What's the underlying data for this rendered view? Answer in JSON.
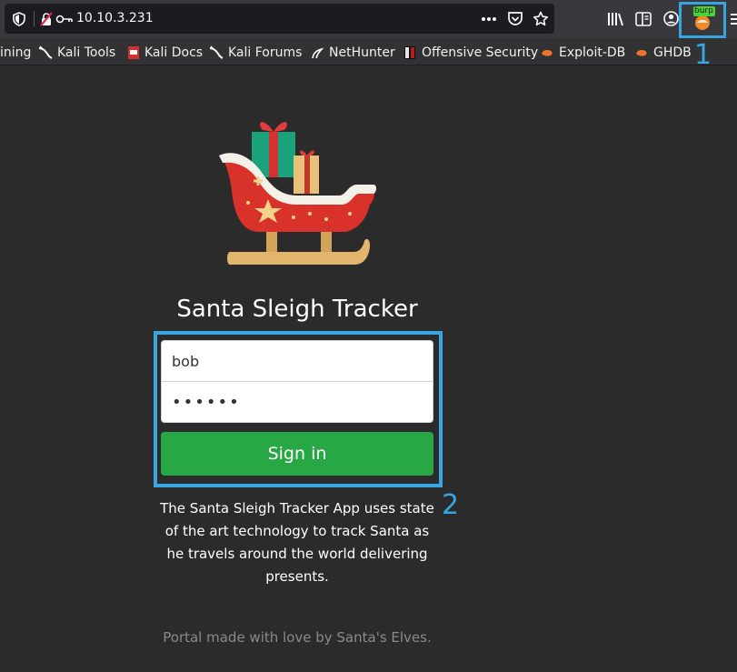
{
  "browser": {
    "url": "10.10.3.231",
    "extension_badge": "burp",
    "icons": [
      "shield-icon",
      "lock-crossed-icon",
      "key-icon",
      "more-icon",
      "pocket-icon",
      "star-icon",
      "library-icon",
      "reader-icon",
      "account-icon",
      "burp-extension-icon",
      "menu-icon"
    ]
  },
  "bookmarks": [
    {
      "label": "ining",
      "icon": "none"
    },
    {
      "label": "Kali Tools",
      "icon": "kali-dragon-icon"
    },
    {
      "label": "Kali Docs",
      "icon": "kali-docs-icon"
    },
    {
      "label": "Kali Forums",
      "icon": "kali-dragon-icon"
    },
    {
      "label": "NetHunter",
      "icon": "nethunter-icon"
    },
    {
      "label": "Offensive Security",
      "icon": "offsec-icon"
    },
    {
      "label": "Exploit-DB",
      "icon": "exploitdb-icon"
    },
    {
      "label": "GHDB",
      "icon": "exploitdb-icon"
    }
  ],
  "annotations": {
    "label_1": "1",
    "label_2": "2",
    "color": "#37a6e0"
  },
  "page": {
    "title": "Santa Sleigh Tracker",
    "username_value": "bob",
    "password_value": "••••••",
    "signin_label": "Sign in",
    "description": "The Santa Sleigh Tracker App uses state of the art technology to track Santa as he travels around the world delivering presents.",
    "footer": "Portal made with love by Santa's Elves.",
    "logo": "sleigh-with-presents-icon"
  },
  "colors": {
    "background": "#2b2b2b",
    "signin_button": "#28a745",
    "footer_text": "#8a8a8a"
  }
}
